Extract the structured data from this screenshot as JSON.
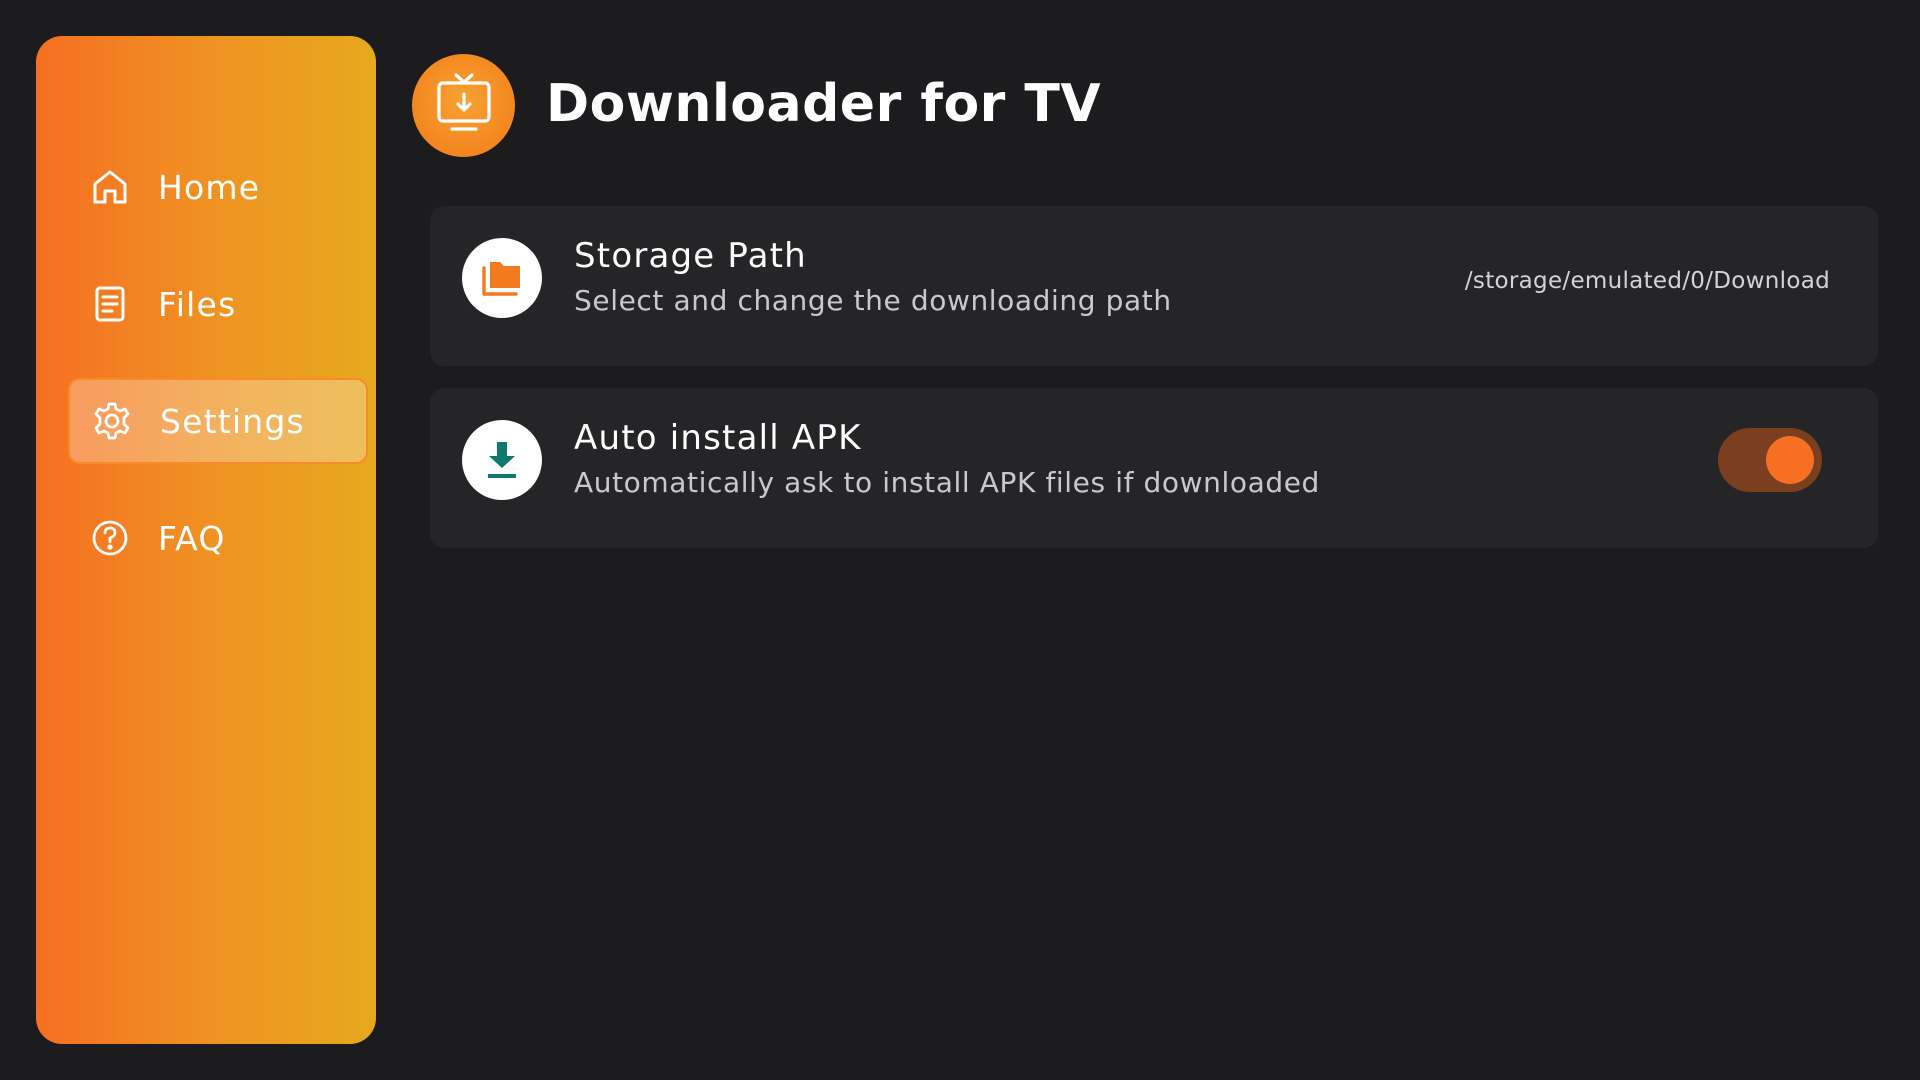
{
  "app": {
    "title": "Downloader for TV",
    "logo_icon": "tv-download-icon"
  },
  "colors": {
    "accent": "#f66f22",
    "sidebar_gradient_start": "#f66f22",
    "sidebar_gradient_end": "#e6a91e",
    "background": "#1c1c1e",
    "card": "#252527",
    "download_icon": "#0f7a6b"
  },
  "sidebar": {
    "items": [
      {
        "label": "Home",
        "icon": "home-icon",
        "active": false
      },
      {
        "label": "Files",
        "icon": "document-icon",
        "active": false
      },
      {
        "label": "Settings",
        "icon": "gear-icon",
        "active": true
      },
      {
        "label": "FAQ",
        "icon": "help-icon",
        "active": false
      }
    ]
  },
  "settings": {
    "storage": {
      "title": "Storage Path",
      "subtitle": "Select and change the downloading path",
      "value": "/storage/emulated/0/Download",
      "icon": "folder-icon"
    },
    "auto_install": {
      "title": "Auto install APK",
      "subtitle": "Automatically ask to install APK files if downloaded",
      "enabled": true,
      "icon": "download-icon"
    }
  }
}
